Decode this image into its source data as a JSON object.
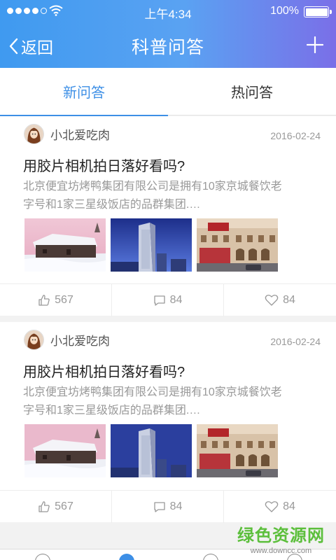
{
  "status": {
    "time": "上午4:34",
    "battery": "100%"
  },
  "nav": {
    "back_label": "返回",
    "title": "科普问答"
  },
  "tabs": [
    {
      "label": "新问答"
    },
    {
      "label": "热问答"
    }
  ],
  "posts": [
    {
      "user": "小北爱吃肉",
      "date": "2016-02-24",
      "question": "用胶片相机拍日落好看吗?",
      "desc_line1": "北京便宜坊烤鸭集团有限公司是拥有10家京城餐饮老",
      "desc_line2": "字号和1家三星级饭店的品群集团.…",
      "likes": "567",
      "comments": "84",
      "favorites": "84"
    },
    {
      "user": "小北爱吃肉",
      "date": "2016-02-24",
      "question": "用胶片相机拍日落好看吗?",
      "desc_line1": "北京便宜坊烤鸭集团有限公司是拥有10家京城餐饮老",
      "desc_line2": "字号和1家三星级饭店的品群集团.…",
      "likes": "567",
      "comments": "84",
      "favorites": "84"
    }
  ],
  "watermark": {
    "line1": "绿色资源网",
    "line2": "www.downcc.com"
  },
  "colors": {
    "accent": "#3d8fe6",
    "header_start": "#3f9af0",
    "header_end": "#7a6fe8"
  }
}
